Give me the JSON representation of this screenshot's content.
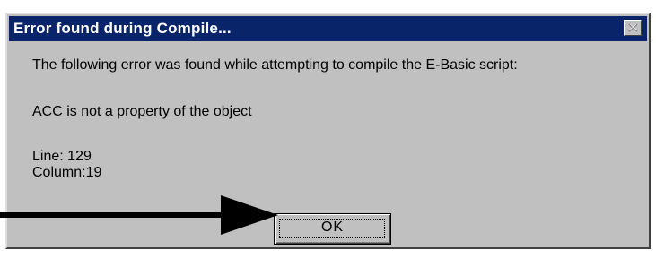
{
  "dialog": {
    "title": "Error found during Compile...",
    "message": "The following error was found while attempting to compile the E-Basic script:",
    "error": "ACC is not a property of the object",
    "line_label": "Line: 129",
    "column_label": "Column:19",
    "ok_label": "OK",
    "close_icon": "close-x-icon"
  },
  "annotation": {
    "arrow_icon": "right-arrow-icon",
    "color": "#000000"
  },
  "colors": {
    "titlebar": "#0a246a",
    "window_face": "#c0c0c0"
  }
}
